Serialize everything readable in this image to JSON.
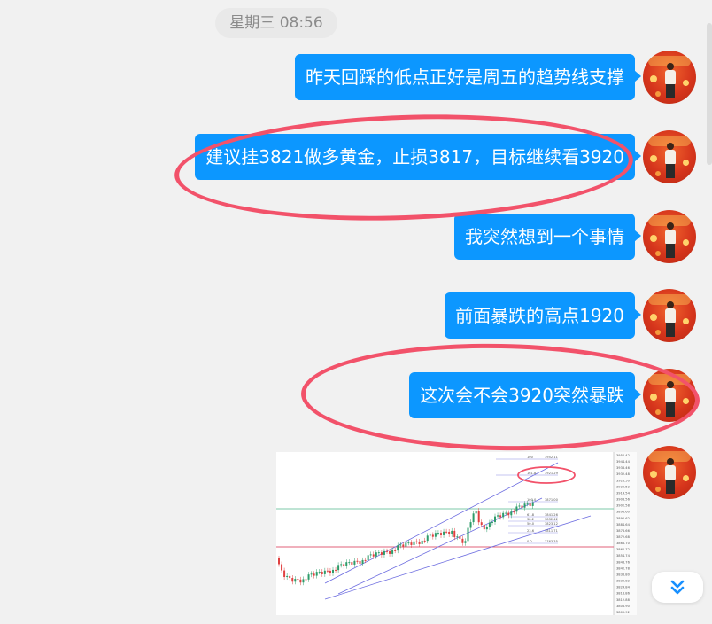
{
  "timestamp": "星期三 08:56",
  "messages": [
    {
      "text": "昨天回踩的低点正好是周五的趋势线支撑"
    },
    {
      "text": "建议挂3821做多黄金，止损3817，目标继续看3920"
    },
    {
      "text": "我突然想到一个事情"
    },
    {
      "text": "前面暴跌的高点1920"
    },
    {
      "text": "这次会不会3920突然暴跌"
    }
  ],
  "chart_labels": {
    "fib_levels": [
      "100",
      "161.8",
      "100.0",
      "61.8",
      "38.2",
      "50.0",
      "23.6",
      "0.0"
    ],
    "fib_values": [
      "3952.11",
      "3921.29",
      "3871.00",
      "3841.26",
      "3832.42",
      "3823.12",
      "3811.71",
      "3763.35"
    ],
    "price_axis": [
      "3950.42",
      "3944.44",
      "3938.46",
      "3932.48",
      "3926.50",
      "3920.52",
      "3914.54",
      "3908.56",
      "3902.58",
      "3896.60",
      "3890.62",
      "3884.64",
      "3878.66",
      "3872.68",
      "3866.70",
      "3860.72",
      "3854.74",
      "3848.76",
      "3842.78",
      "3836.80",
      "3830.82",
      "3824.84",
      "3818.86",
      "3812.88",
      "3806.90",
      "3800.92"
    ]
  },
  "colors": {
    "bubble": "#0c97ff",
    "highlight": "#f2526a",
    "candle_up": "#2e9c6a",
    "candle_down": "#e04040"
  },
  "icons": {
    "scroll_down": "double-chevron-down-icon"
  }
}
